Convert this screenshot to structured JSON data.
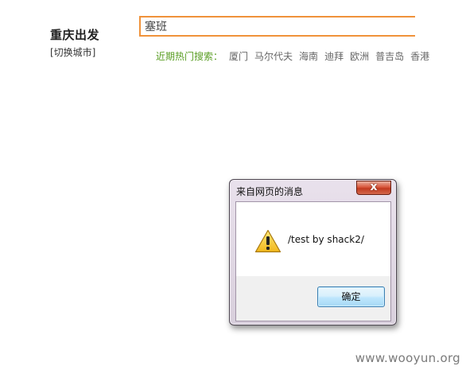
{
  "departure": {
    "city": "重庆出发",
    "switch_label": "[切换城市]"
  },
  "search": {
    "value": "塞班"
  },
  "hot_search": {
    "label": "近期热门搜索：",
    "items": [
      "厦门",
      "马尔代夫",
      "海南",
      "迪拜",
      "欧洲",
      "普吉岛",
      "香港"
    ]
  },
  "dialog": {
    "title": "来自网页的消息",
    "message": "/test by shack2/",
    "ok_label": "确定",
    "close_symbol": "x"
  },
  "watermark": "www.wooyun.org",
  "colors": {
    "search_border": "#f0923a",
    "hot_label": "#5a9e24",
    "close_button": "#c13a1f",
    "ok_button_border": "#3c7fb1"
  },
  "icons": {
    "dialog_icon": "warning-icon"
  }
}
